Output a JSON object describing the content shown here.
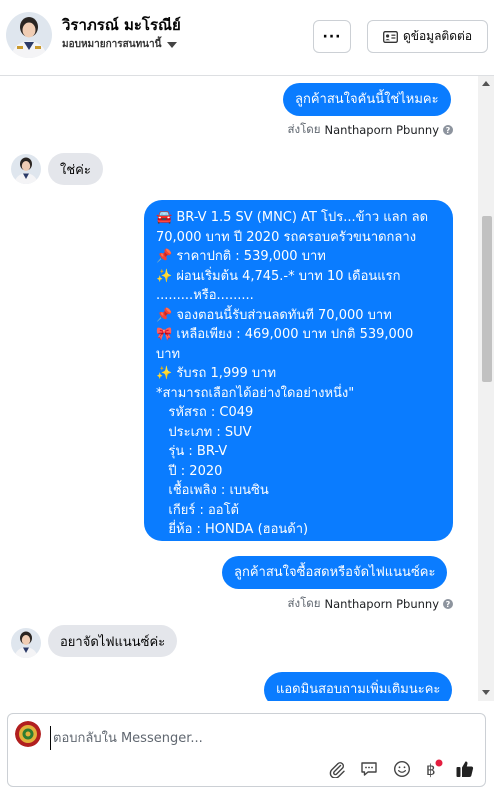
{
  "header": {
    "name": "วิราภรณ์ มะโรณีย์",
    "assign_label": "มอบหมายการสนทนานี้",
    "more_button": "···",
    "contact_button": "ดูข้อมูลติดต่อ"
  },
  "messages": {
    "out1": "ลูกค้าสนใจคันนี้ใช่ไหมคะ",
    "sent_by_prefix": "ส่งโดย",
    "sent_by_name": "Nanthaporn Pbunny",
    "in1": "ใช่ค่ะ",
    "car_lines": [
      "🚘 BR-V 1.5 SV (MNC) AT โปร...ข้าว แลก ลด",
      "70,000 บาท ปี 2020 รถครอบครัวขนาดกลาง",
      "📌 ราคาปกติ : 539,000 บาท",
      "✨ ผ่อนเริ่มต้น 4,745.-* บาท 10 เดือนแรก",
      ".........หรือ.........",
      "📌 จองตอนนี้รับส่วนลดทันที 70,000 บาท",
      "🎀 เหลือเพียง : 469,000 บาท ปกติ 539,000",
      "บาท",
      "✨ รับรถ 1,999 บาท",
      "*สามารถเลือกได้อย่างใดอย่างหนึ่ง\"",
      "   รหัสรถ : C049",
      "   ประเภท : SUV",
      "   รุ่น : BR-V",
      "   ปี : 2020",
      "   เชื้อเพลิง : เบนซิน",
      "   เกียร์ : ออโต้",
      "   ยี่ห้อ : HONDA (ฮอนด้า)"
    ],
    "out3": "ลูกค้าสนใจซื้อสดหรือจัดไฟแนนซ์คะ",
    "in2": "อยาจัดไฟแนนซ์ค่ะ",
    "out4": "แอดมินสอบถามเพิ่มเติมนะคะ"
  },
  "composer": {
    "placeholder": "ตอบกลับใน Messenger..."
  },
  "colors": {
    "outgoing_bubble": "#0a7cff",
    "incoming_bubble": "#e4e6eb"
  },
  "icons": [
    "profile-avatar",
    "chevron-down-icon",
    "more-icon",
    "contact-card-icon",
    "info-icon",
    "paperclip-icon",
    "chat-icon",
    "emoji-icon",
    "baht-icon",
    "thumbs-up-icon"
  ]
}
